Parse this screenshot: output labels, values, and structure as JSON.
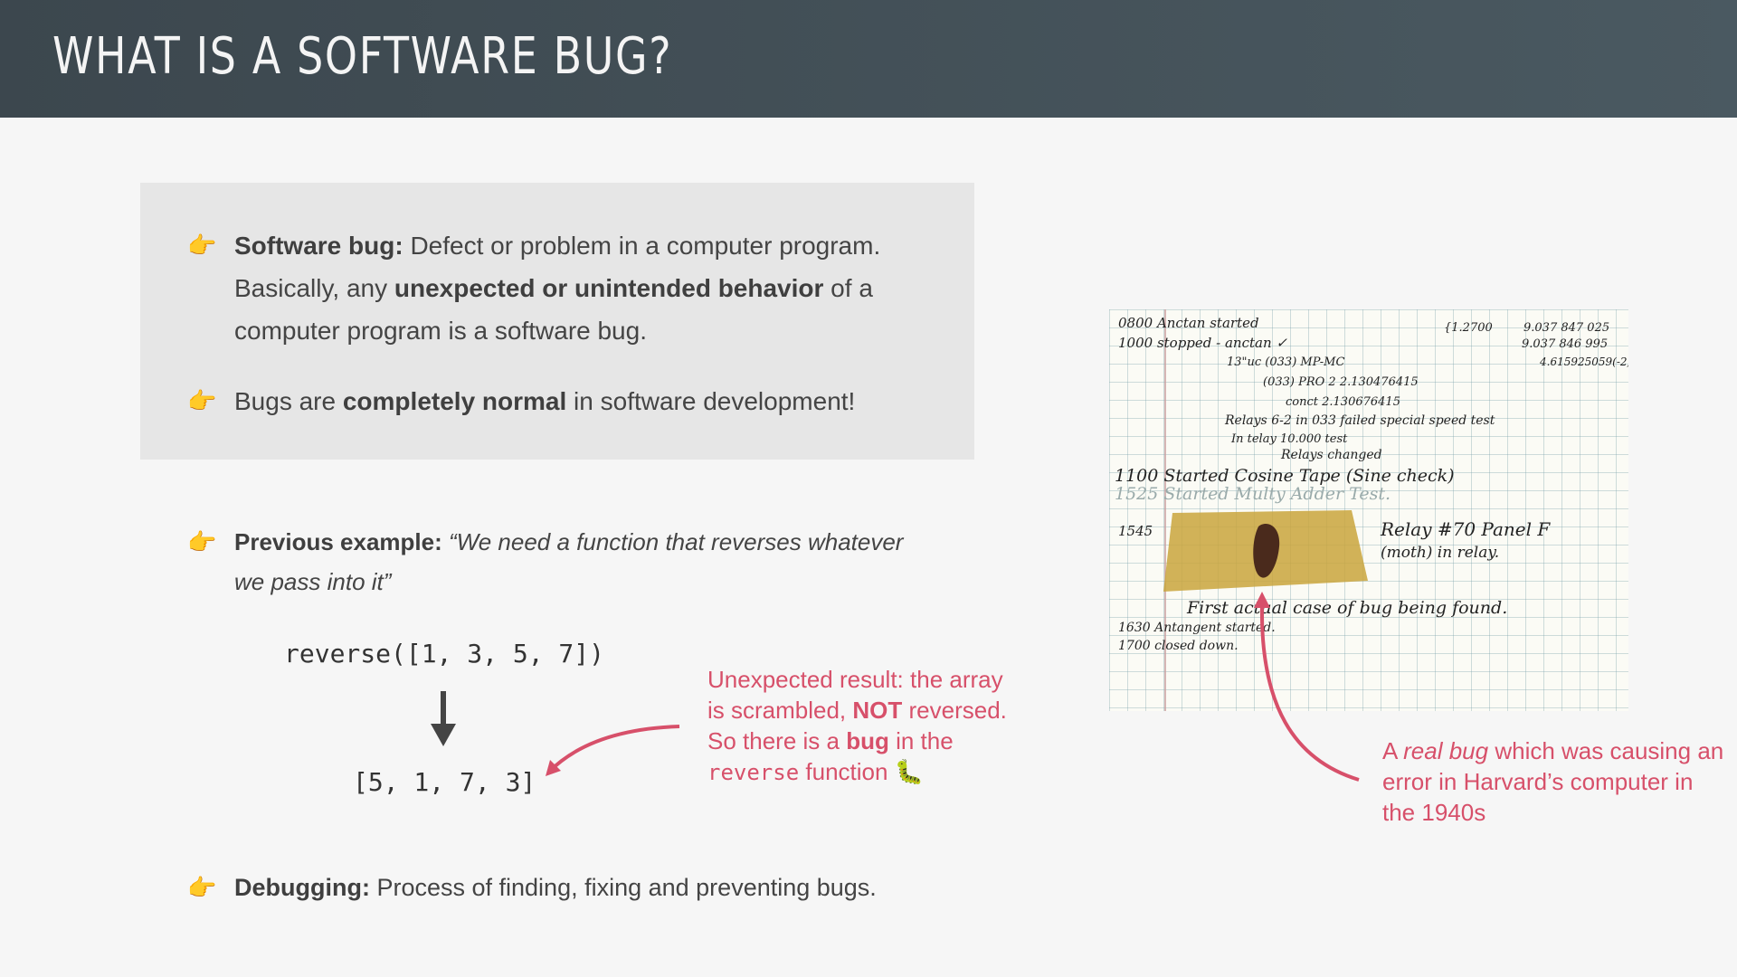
{
  "header": {
    "title": "What is a Software Bug?"
  },
  "definition": {
    "b1_term": "Software bug:",
    "b1_text1": " Defect or problem in a computer program. Basically, any ",
    "b1_bold": "unexpected or unintended behavior",
    "b1_text2": " of a computer program is a software bug.",
    "b2_text1": "Bugs are ",
    "b2_bold": "completely normal",
    "b2_text2": " in software development!"
  },
  "example": {
    "term": "Previous example:",
    "quote": " “We need a function that reverses whatever we pass into it”",
    "code_call": "reverse([1, 3, 5, 7])",
    "code_result": "[5, 1, 7, 3]",
    "note_p1": "Unexpected result: the array is scrambled, ",
    "note_not": "NOT",
    "note_p2": " reversed. So there is a ",
    "note_bug": "bug",
    "note_p3": " in the ",
    "note_fn": "reverse",
    "note_p4": " function 🐛"
  },
  "photo_note": {
    "p1": "A ",
    "italic": "real bug",
    "p2": " which was causing an error in Harvard’s computer in the 1940s"
  },
  "logbook": {
    "lines": [
      "0800  Anctan started",
      "1000     stopped - anctan ✓",
      "13\"uc (033) MP-MC",
      "(033) PRO 2   2.130476415",
      "conct   2.130676415",
      "Relays 6-2 in 033 failed special speed test",
      "In telay      10.000 test",
      "Relays changed",
      "1100  Started Cosine Tape (Sine check)",
      "1525  Started Multy Adder Test.",
      "1545",
      "Relay #70 Panel F",
      "(moth) in relay.",
      "First actual case of bug being found.",
      "1630  Antangent started.",
      "1700  closed down."
    ],
    "numbers": [
      "{1.2700",
      "9.037 847 025",
      "9.037 846 995",
      "4.615925059(-2)"
    ]
  },
  "debugging": {
    "term": "Debugging:",
    "text": " Process of finding, fixing and preventing bugs."
  },
  "icons": {
    "bullet": "pointing-hand-icon",
    "bug": "bug-icon"
  },
  "colors": {
    "accent": "#d7506a",
    "header": "#3f4a51",
    "bullet": "#e2a91b"
  }
}
